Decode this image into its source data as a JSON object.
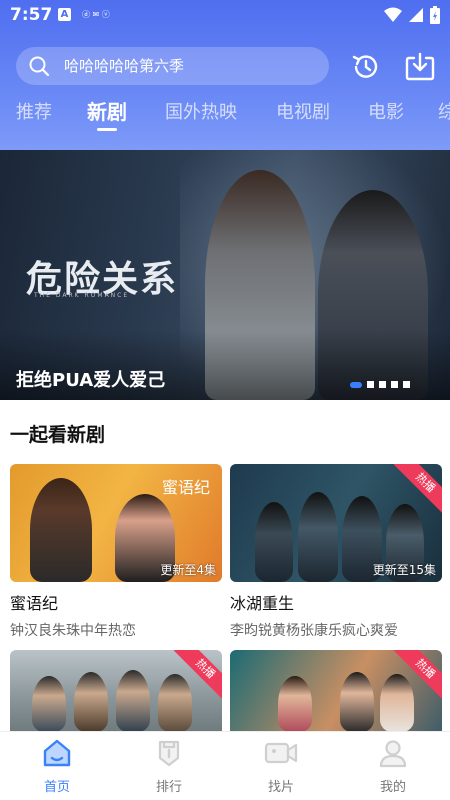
{
  "status": {
    "time": "7:57",
    "app_badge": "A",
    "mini_text": "ⓓ ✉ ⓥ"
  },
  "search": {
    "placeholder": "哈哈哈哈哈第六季"
  },
  "tabs": [
    "推荐",
    "新剧",
    "国外热映",
    "电视剧",
    "电影",
    "综"
  ],
  "banner": {
    "art_title": "危险关系",
    "art_subtitle": "THE DARK ROMANCE",
    "caption": "拒绝PUA爱人爱己"
  },
  "section": {
    "title": "一起看新剧"
  },
  "cards": [
    {
      "title": "蜜语纪",
      "subtitle": "钟汉良朱珠中年热恋",
      "episode": "更新至4集",
      "art": "蜜语纪",
      "hot": false
    },
    {
      "title": "冰湖重生",
      "subtitle": "李昀锐黄杨张康乐疯心爽爱",
      "episode": "更新至15集",
      "hot": true,
      "hot_label": "热播"
    },
    {
      "title": "",
      "subtitle": "",
      "hot": true,
      "hot_label": "热播"
    },
    {
      "title": "",
      "subtitle": "",
      "hot": true,
      "hot_label": "热播"
    }
  ],
  "tabbar": [
    {
      "label": "首页",
      "icon": "home-icon",
      "active": true
    },
    {
      "label": "排行",
      "icon": "ranking-icon",
      "active": false
    },
    {
      "label": "找片",
      "icon": "video-camera-icon",
      "active": false
    },
    {
      "label": "我的",
      "icon": "user-icon",
      "active": false
    }
  ],
  "colors": {
    "primary": "#3b82f6",
    "header": "#5c7df2",
    "hot": "#ef3b5b"
  }
}
